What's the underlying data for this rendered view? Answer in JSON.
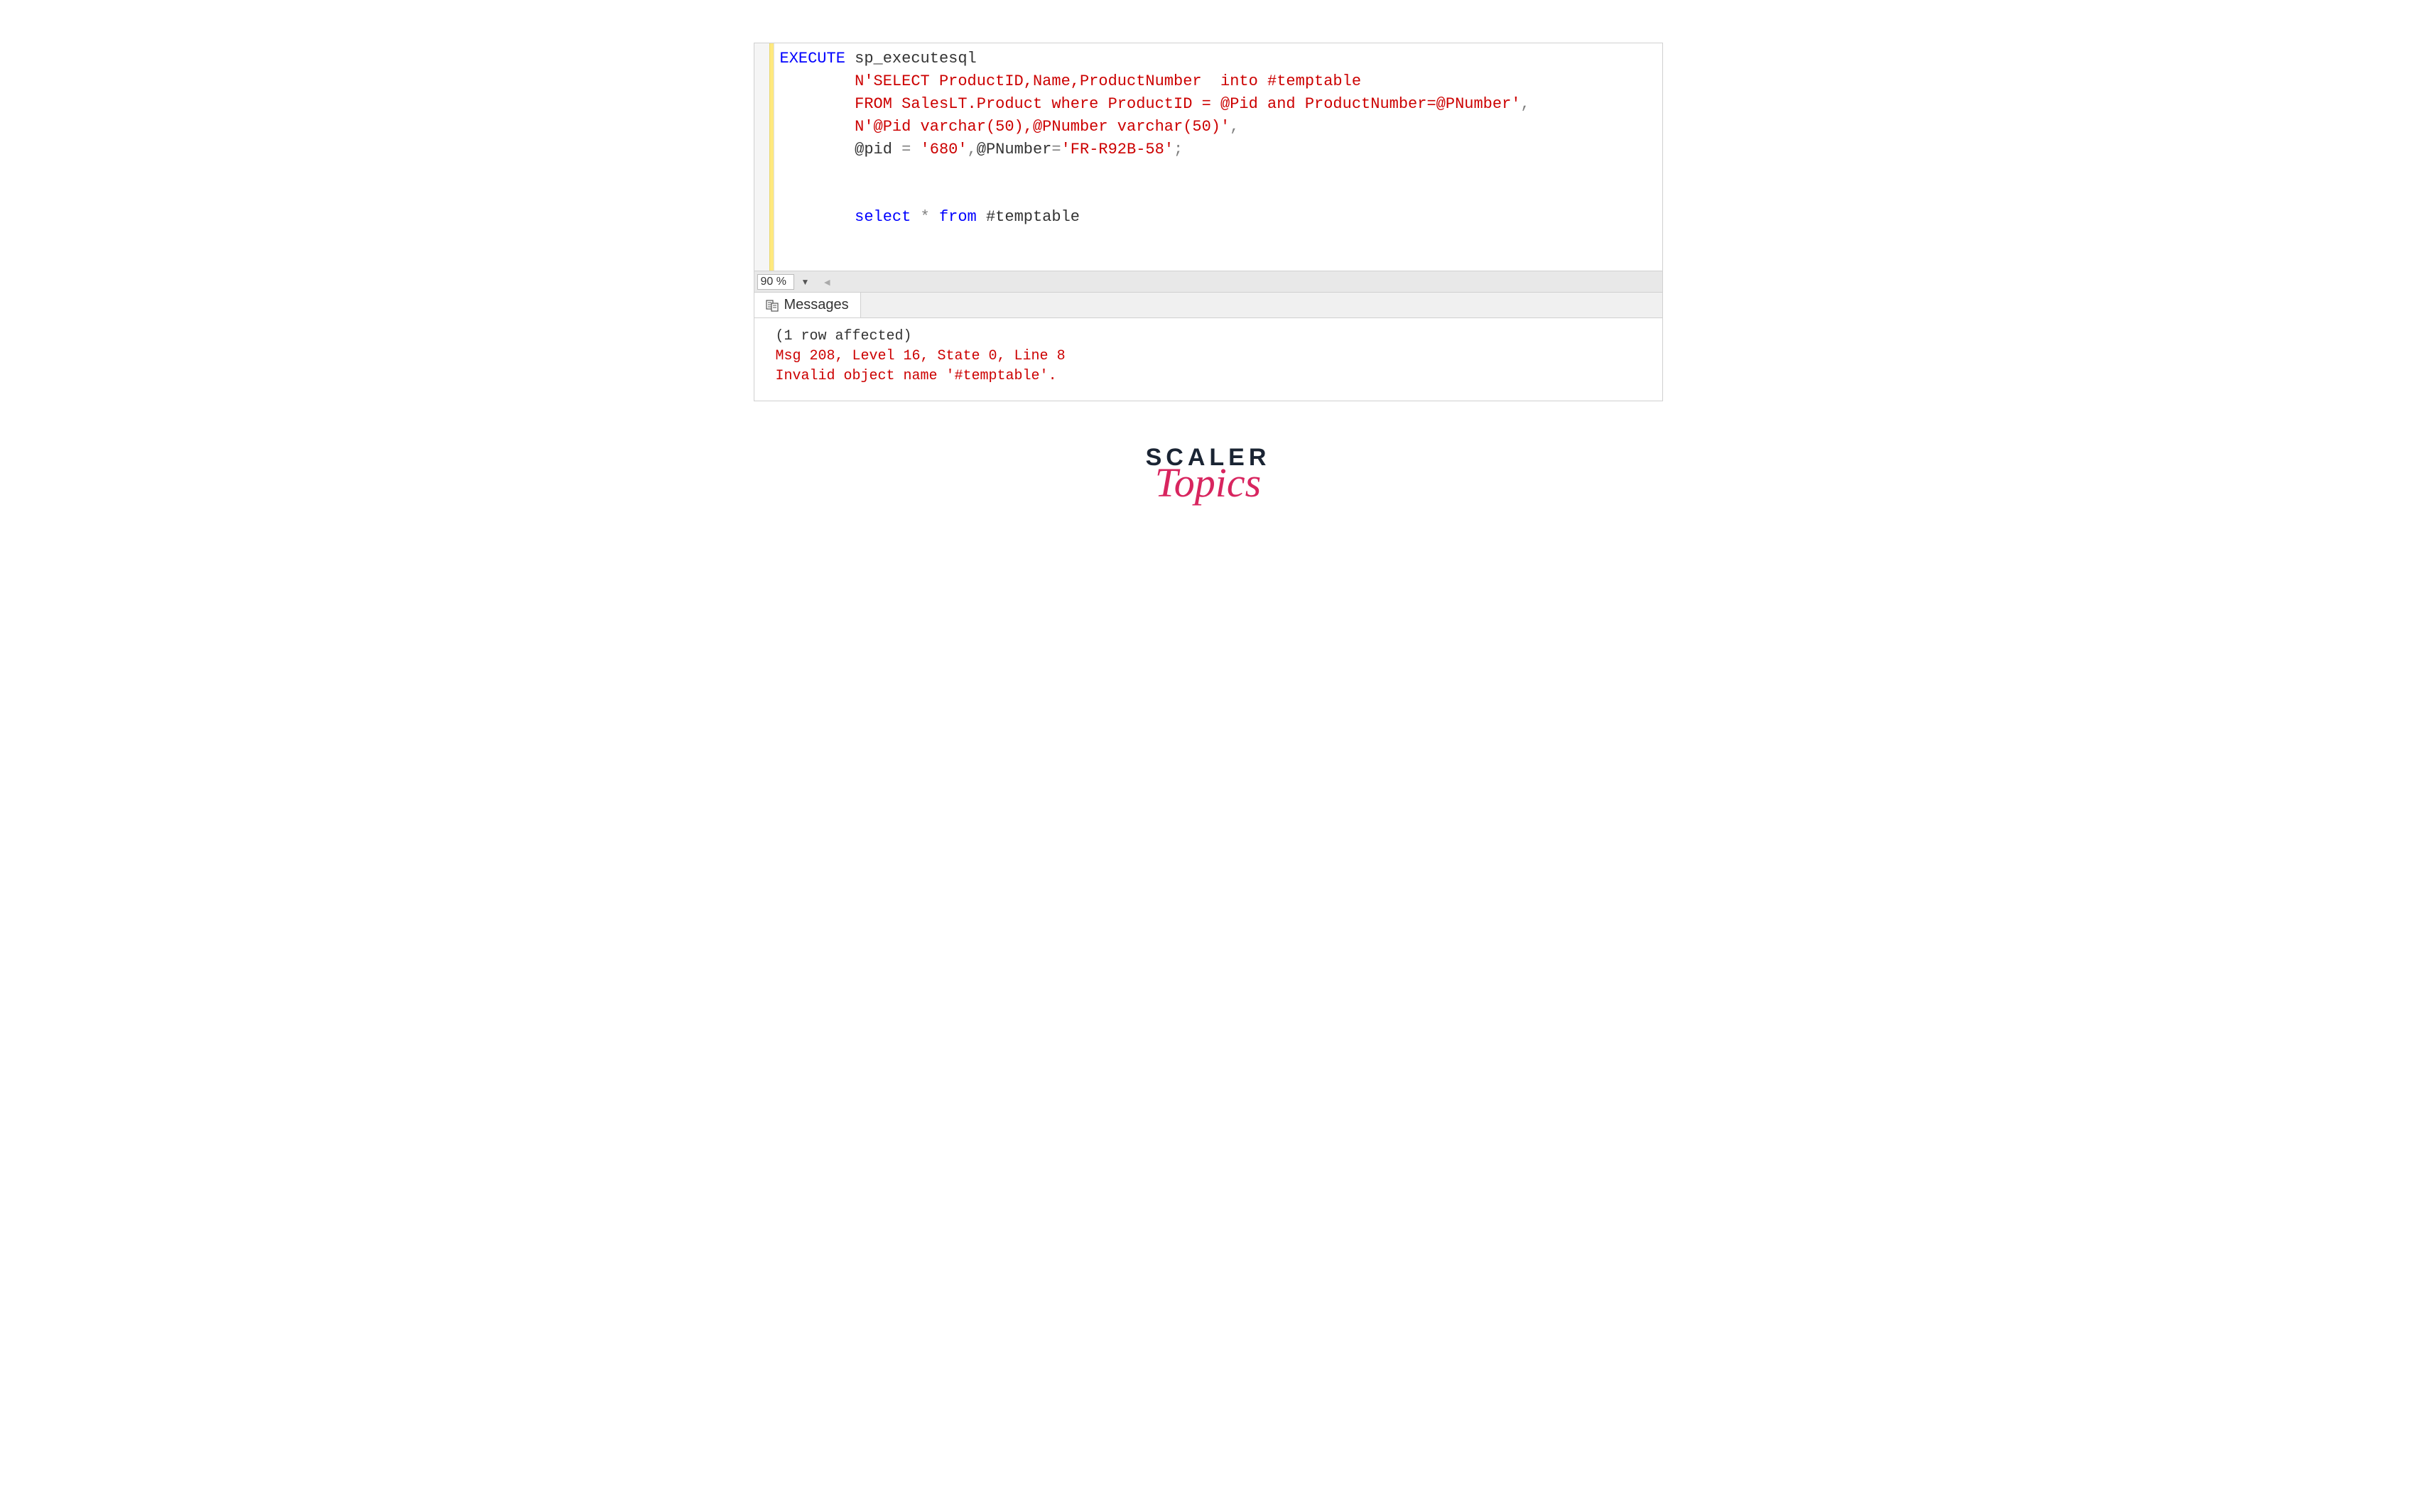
{
  "editor": {
    "line1_kw": "EXECUTE",
    "line1_proc": " sp_executesql",
    "line2_str": "N'SELECT ProductID,Name,ProductNumber  into #temptable",
    "line3_str": "FROM SalesLT.Product where ProductID = @Pid and ProductNumber=@PNumber'",
    "line3_comma": ",",
    "line4_str": "N'@Pid varchar(50),@PNumber varchar(50)'",
    "line4_comma": ",",
    "line5_a": "@pid ",
    "line5_eq1": "=",
    "line5_v1": " '680'",
    "line5_c1": ",",
    "line5_b": "@PNumber",
    "line5_eq2": "=",
    "line5_v2": "'FR-R92B-58'",
    "line5_semi": ";",
    "line8_sel": "select",
    "line8_star": " * ",
    "line8_from": "from",
    "line8_tbl": " #temptable",
    "indent": "        "
  },
  "status": {
    "zoom": "90 %"
  },
  "tabs": {
    "messages_label": "Messages"
  },
  "messages": {
    "line1": "(1 row affected)",
    "line2": "Msg 208, Level 16, State 0, Line 8",
    "line3": "Invalid object name '#temptable'."
  },
  "brand": {
    "scaler": "SCALER",
    "topics": "Topics"
  }
}
